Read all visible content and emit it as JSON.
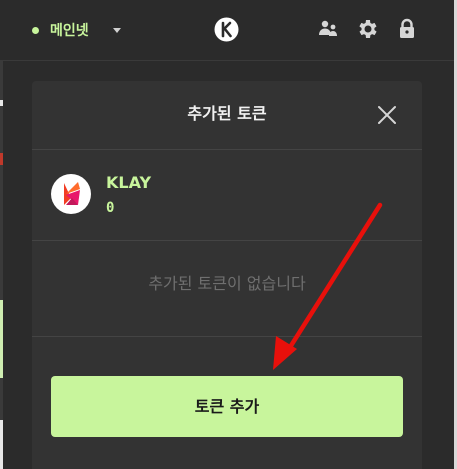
{
  "topbar": {
    "network_label": "메인넷",
    "network_status_color": "#c8f59c",
    "logo_icon": "klaytn-logo-icon",
    "icons": [
      "accounts-icon",
      "gear-icon",
      "lock-icon"
    ]
  },
  "modal": {
    "title": "추가된 토큰",
    "close_icon": "close-icon",
    "token": {
      "symbol": "KLAY",
      "balance": "0",
      "icon": "klay-token-icon"
    },
    "empty_message": "추가된 토큰이 없습니다",
    "add_button_label": "토큰 추가"
  },
  "colors": {
    "accent": "#c8f59c",
    "background": "#2b2b2b",
    "panel": "#333333",
    "annotation_arrow": "#e8100b"
  }
}
